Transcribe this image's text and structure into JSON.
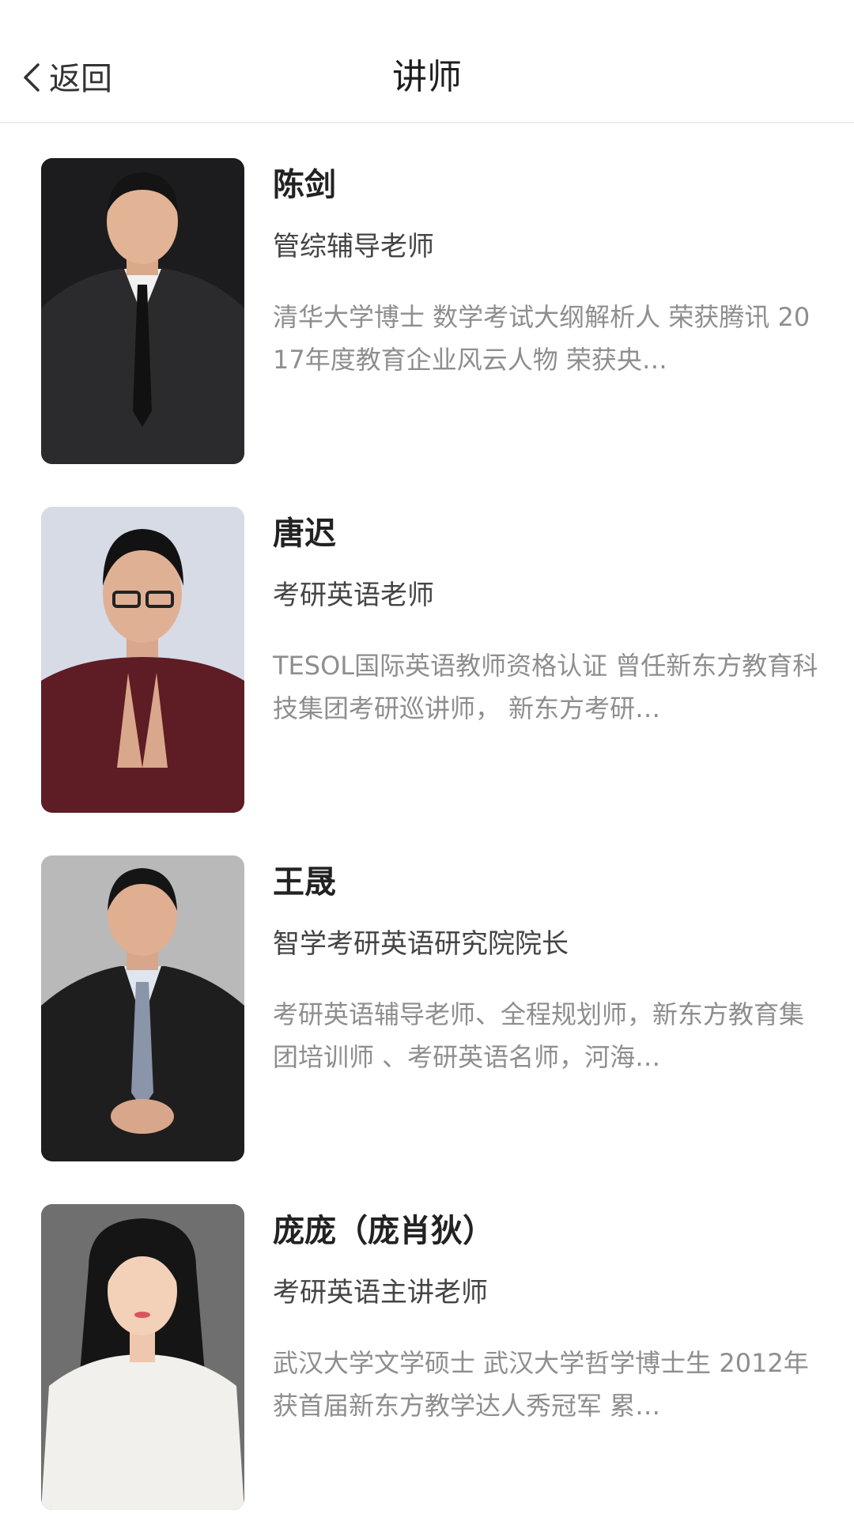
{
  "header": {
    "back_label": "返回",
    "title": "讲师"
  },
  "teachers": [
    {
      "name": "陈剑",
      "role": "管综辅导老师",
      "bio": "清华大学博士 数学考试大纲解析人 荣获腾讯 2017年度教育企业风云人物 荣获央…"
    },
    {
      "name": "唐迟",
      "role": "考研英语老师",
      "bio": "TESOL国际英语教师资格认证 曾任新东方教育科技集团考研巡讲师， 新东方考研…"
    },
    {
      "name": "王晟",
      "role": "智学考研英语研究院院长",
      "bio": "考研英语辅导老师、全程规划师，新东方教育集团培训师 、考研英语名师，河海…"
    },
    {
      "name": "庞庞（庞肖狄）",
      "role": "考研英语主讲老师",
      "bio": "武汉大学文学硕士 武汉大学哲学博士生 2012年获首届新东方教学达人秀冠军 累…"
    }
  ],
  "colors": {
    "title": "#1f1f1f",
    "name": "#222222",
    "role": "#444444",
    "bio": "#8e8e8e",
    "divider": "#ececec"
  }
}
